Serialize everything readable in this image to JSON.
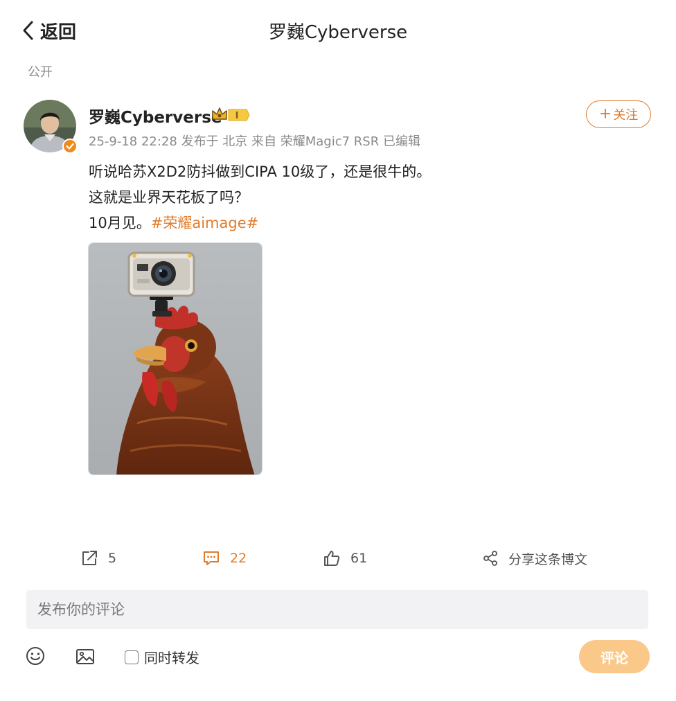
{
  "header": {
    "back_label": "返回",
    "title": "罗巍Cyberverse"
  },
  "visibility": "公开",
  "post": {
    "author": "罗巍Cyberverse",
    "level": "I",
    "meta": "25-9-18 22:28 发布于 北京 来自 荣耀Magic7 RSR 已编辑",
    "follow_label": "关注",
    "lines": [
      "听说哈苏X2D2防抖做到CIPA 10级了，还是很牛的。",
      "这就是业界天花板了吗？",
      "10月见。"
    ],
    "hashtag": "#荣耀aimage#"
  },
  "actions": {
    "repost_count": "5",
    "comment_count": "22",
    "like_count": "61",
    "share_label": "分享这条博文"
  },
  "composer": {
    "placeholder": "发布你的评论",
    "repost_label": "同时转发",
    "submit_label": "评论"
  },
  "colors": {
    "accent": "#e07b2c",
    "submit_bg": "#fac98a",
    "muted": "#8a8a8a"
  },
  "icons": [
    "chevron-left-icon",
    "crown-icon",
    "verified-icon",
    "repost-icon",
    "comment-icon",
    "like-icon",
    "share-icon",
    "emoji-icon",
    "image-icon"
  ]
}
